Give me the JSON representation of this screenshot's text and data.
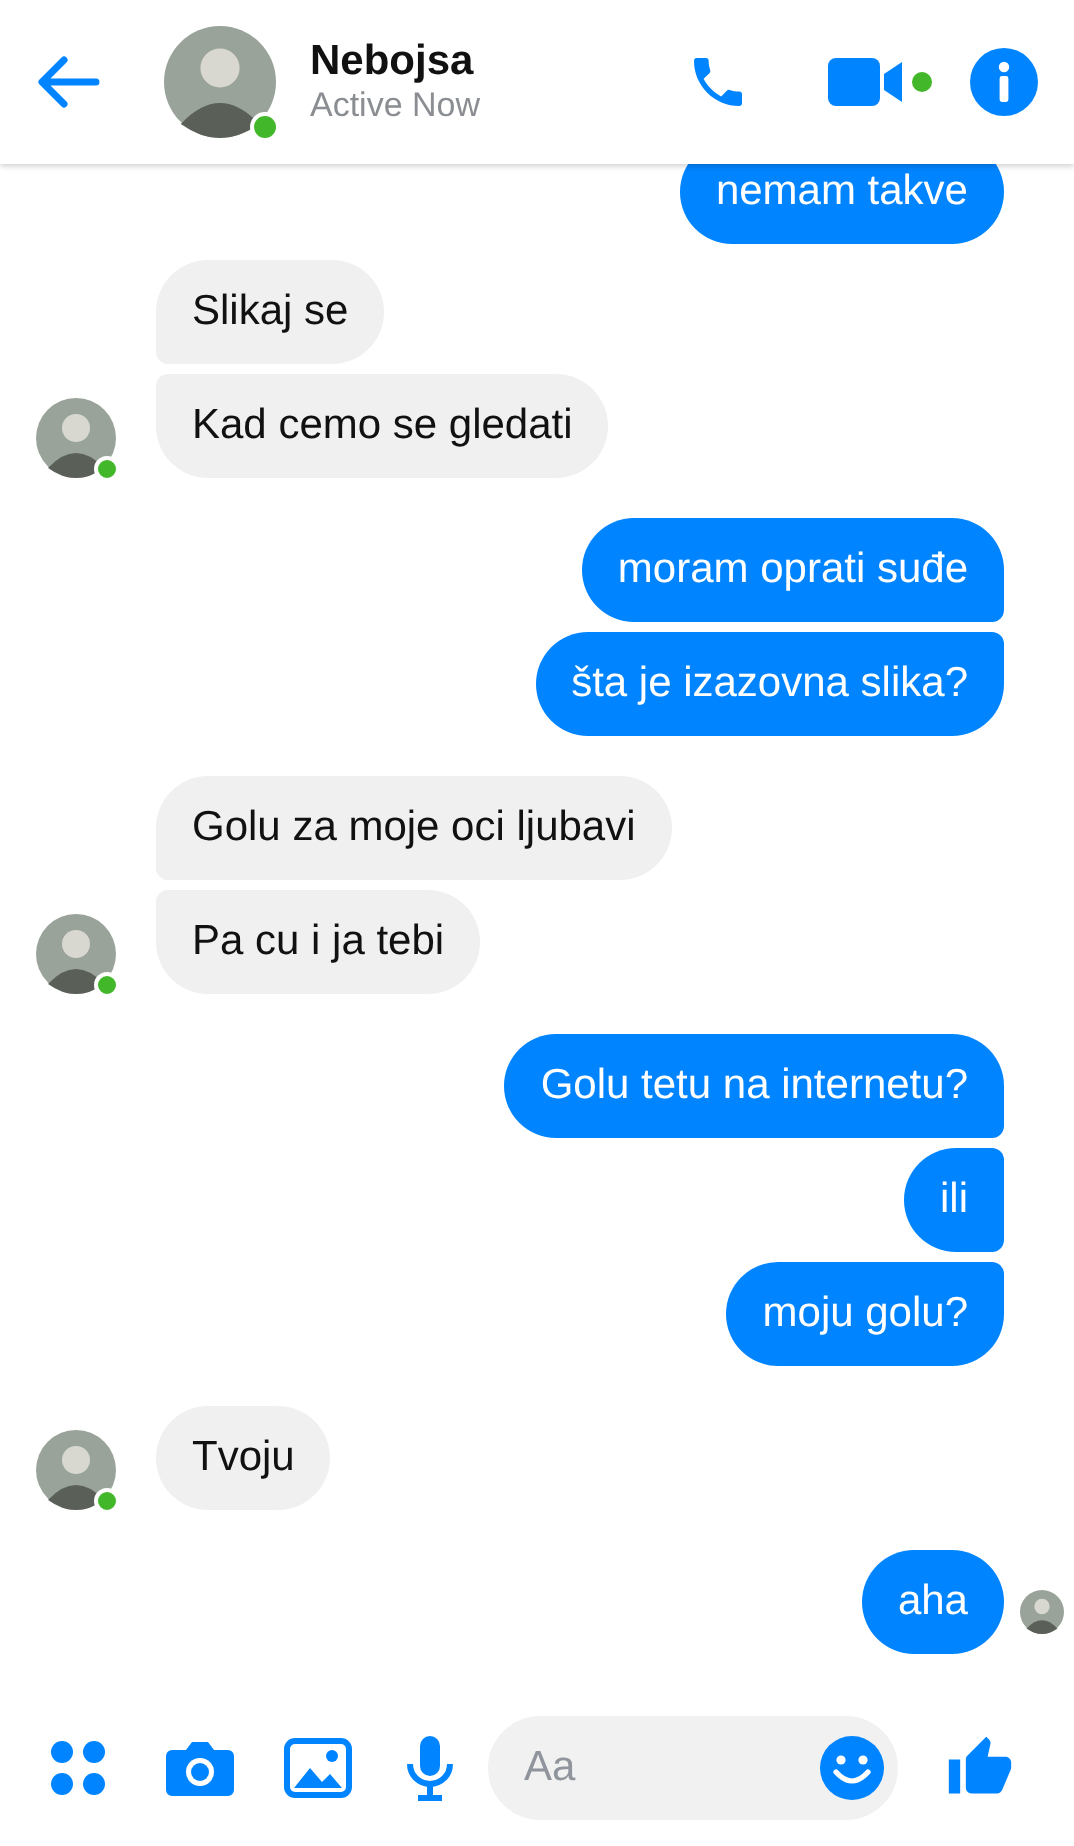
{
  "header": {
    "name": "Nebojsa",
    "status": "Active Now",
    "online": true
  },
  "messages": [
    {
      "kind": "sent",
      "text": "nemam takve"
    },
    {
      "kind": "received",
      "text": "Slikaj se"
    },
    {
      "kind": "received",
      "text": "Kad cemo se gledati",
      "show_avatar": true,
      "online": true
    },
    {
      "kind": "sent",
      "text": "moram oprati suđe"
    },
    {
      "kind": "sent",
      "text": "šta je izazovna slika?"
    },
    {
      "kind": "received",
      "text": "Golu za moje oci ljubavi"
    },
    {
      "kind": "received",
      "text": "Pa cu i ja tebi",
      "show_avatar": true,
      "online": true
    },
    {
      "kind": "sent",
      "text": "Golu tetu na internetu?"
    },
    {
      "kind": "sent",
      "text": "ili"
    },
    {
      "kind": "sent",
      "text": "moju golu?"
    },
    {
      "kind": "received",
      "text": "Tvoju",
      "show_avatar": true,
      "online": true
    },
    {
      "kind": "sent",
      "text": "aha",
      "seen": true
    }
  ],
  "composer": {
    "placeholder": "Aa"
  }
}
